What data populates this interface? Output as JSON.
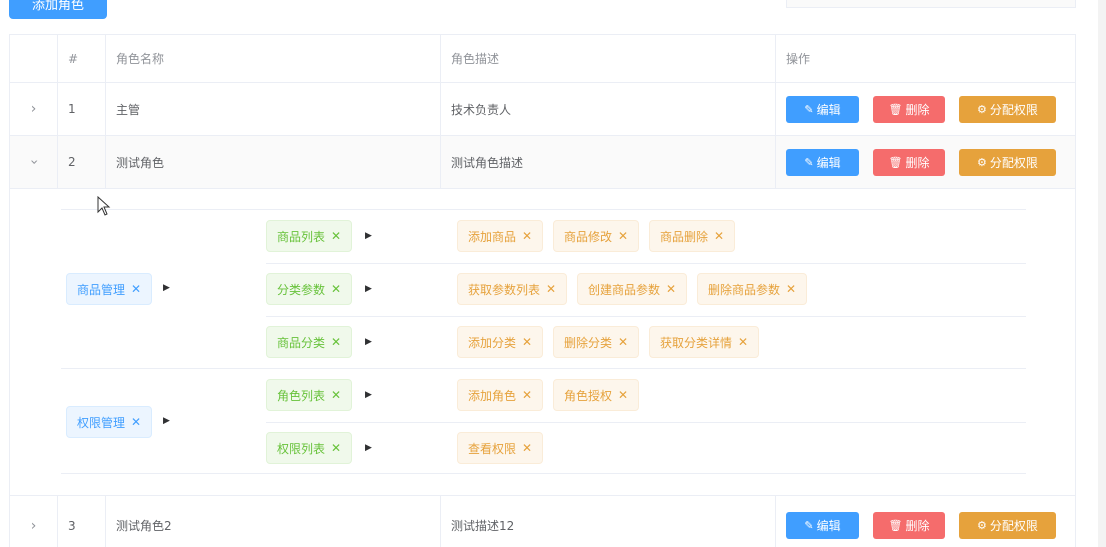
{
  "toolbar": {
    "add_role_label": "添加角色"
  },
  "table": {
    "headers": {
      "index": "#",
      "name": "角色名称",
      "desc": "角色描述",
      "ops": "操作"
    },
    "rows": [
      {
        "index": "1",
        "name": "主管",
        "desc": "技术负责人"
      },
      {
        "index": "2",
        "name": "测试角色",
        "desc": "测试角色描述"
      },
      {
        "index": "3",
        "name": "测试角色2",
        "desc": "测试描述12"
      }
    ],
    "ops": {
      "edit": "编辑",
      "delete": "删除",
      "assign": "分配权限"
    }
  },
  "rights": {
    "l1": [
      {
        "label": "商品管理",
        "l2": [
          {
            "label": "商品列表",
            "l3": [
              "添加商品",
              "商品修改",
              "商品删除"
            ]
          },
          {
            "label": "分类参数",
            "l3": [
              "获取参数列表",
              "创建商品参数",
              "删除商品参数"
            ]
          },
          {
            "label": "商品分类",
            "l3": [
              "添加分类",
              "删除分类",
              "获取分类详情"
            ]
          }
        ]
      },
      {
        "label": "权限管理",
        "l2": [
          {
            "label": "角色列表",
            "l3": [
              "添加角色",
              "角色授权"
            ]
          },
          {
            "label": "权限列表",
            "l3": [
              "查看权限"
            ]
          }
        ]
      }
    ]
  },
  "colors": {
    "primary": "#409eff",
    "danger": "#f56c6c",
    "warning": "#e6a23c",
    "success": "#67c23a"
  },
  "icons": {
    "expand": "chevron-right-icon",
    "collapse": "chevron-down-icon",
    "close": "close-icon",
    "edit": "edit-icon",
    "delete": "trash-icon",
    "assign": "setting-icon"
  }
}
